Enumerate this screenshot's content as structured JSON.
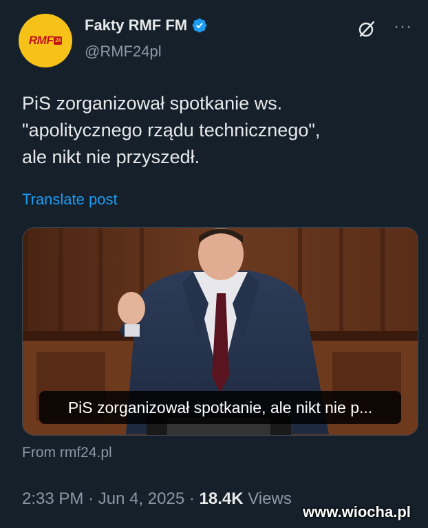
{
  "author": {
    "display_name": "Fakty RMF FM",
    "handle": "@RMF24pl",
    "avatar_logo": "RMF",
    "avatar_badge": "24",
    "verified": true,
    "verified_color": "#1d9bf0"
  },
  "tweet": {
    "text_lines": [
      "PiS zorganizował spotkanie ws.",
      "\"apolitycznego rządu technicznego\",",
      "ale nikt nie przyszedł."
    ],
    "translate_label": "Translate post",
    "media_caption": "PiS zorganizował spotkanie, ale nikt nie p...",
    "source": "From rmf24.pl",
    "time": "2:33 PM",
    "date": "Jun 4, 2025",
    "views_count": "18.4K",
    "views_label": "Views"
  },
  "actions": {
    "grok_icon": "grok-icon",
    "more_icon": "more-icon"
  },
  "watermark": "www.wiocha.pl",
  "colors": {
    "background": "#15202b",
    "text": "#e7e9ea",
    "secondary": "#8b98a5",
    "link": "#1d9bf0",
    "avatar_bg": "#f6c21a",
    "avatar_logo": "#c4121a"
  }
}
